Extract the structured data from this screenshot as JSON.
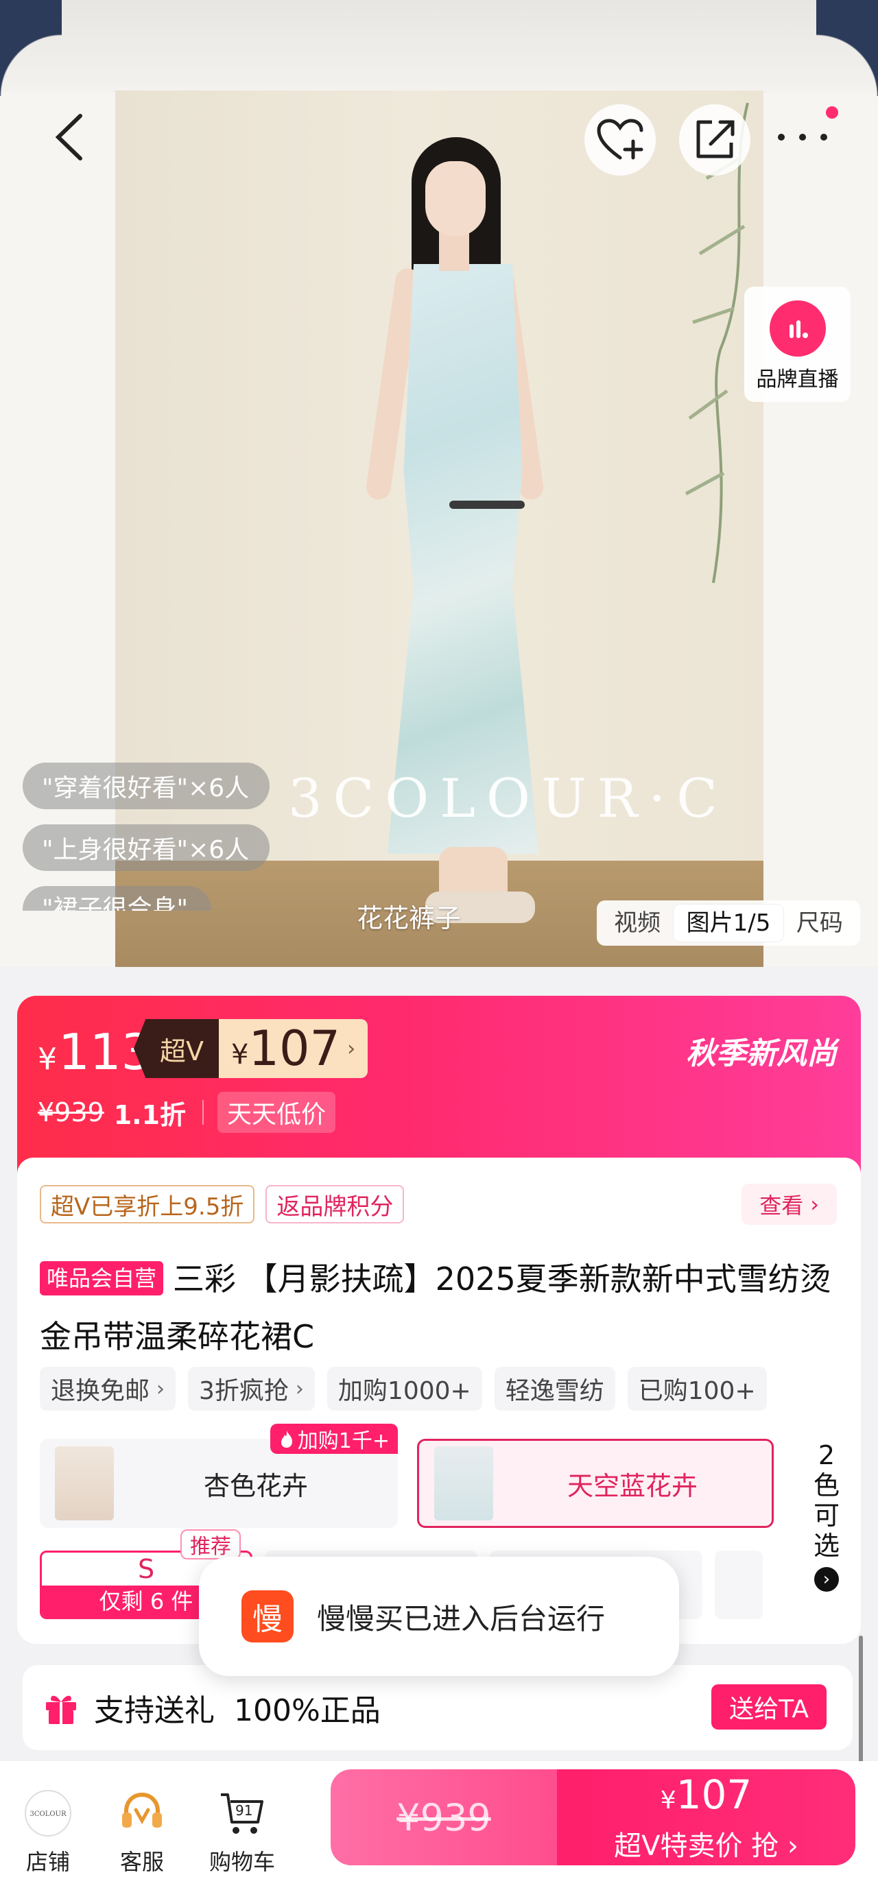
{
  "hero": {
    "brand_watermark": "3COLOUR·C",
    "caption": "花花裤子",
    "live_label": "品牌直播",
    "review_bubbles": [
      "\"穿着很好看\"×6人",
      "\"上身很好看\"×6人",
      "\"裙子很合身\""
    ],
    "media_tabs": [
      "视频",
      "图片1/5",
      "尺码"
    ],
    "active_media_tab": "图片1/5"
  },
  "price": {
    "current": "113",
    "currency": "¥",
    "superv_label": "超Ⅴ",
    "superv_price": "107",
    "season_text": "秋季新风尚",
    "original": "¥939",
    "discount": "1.1折",
    "low_price_badge": "天天低价"
  },
  "benefits": {
    "superv_discount": "超Ⅴ已享折上9.5折",
    "points": "返品牌积分",
    "view_label": "查看"
  },
  "product": {
    "vip_badge": "唯品会自营",
    "title": "三彩 【月影扶疏】2025夏季新款新中式雪纺烫金吊带温柔碎花裙C"
  },
  "feature_tags": [
    {
      "label": "退换免邮",
      "chevron": "›"
    },
    {
      "label": "3折疯抢",
      "chevron": "›"
    },
    {
      "label": "加购1000+",
      "chevron": ""
    },
    {
      "label": "轻逸雪纺",
      "chevron": ""
    },
    {
      "label": "已购100+",
      "chevron": ""
    }
  ],
  "colors": {
    "options": [
      "杏色花卉",
      "天空蓝花卉"
    ],
    "selected": "天空蓝花卉",
    "hot_badge": "加购1千+",
    "more_label": "2色可选"
  },
  "sizes": {
    "selected_letter": "S",
    "stock_note": "仅剩 6 件",
    "recommend_badge": "推荐"
  },
  "toast": {
    "icon_char": "慢",
    "text": "慢慢买已进入后台运行"
  },
  "gift_bar": {
    "gift_text": "支持送礼",
    "genuine_text": "100%正品",
    "send_button": "送给TA"
  },
  "bottom_nav": {
    "shop_label": "店铺",
    "shop_logo_text": "3COLOUR",
    "service_label": "客服",
    "cart_label": "购物车",
    "cart_count": "91"
  },
  "buy": {
    "original_price": "¥939",
    "price": "107",
    "label": "超Ⅴ特卖价 抢 ›"
  },
  "colors_theme": {
    "accent": "#ff1f6b",
    "price_gradient_start": "#ff2d4a",
    "price_gradient_end": "#ff3d9a"
  }
}
